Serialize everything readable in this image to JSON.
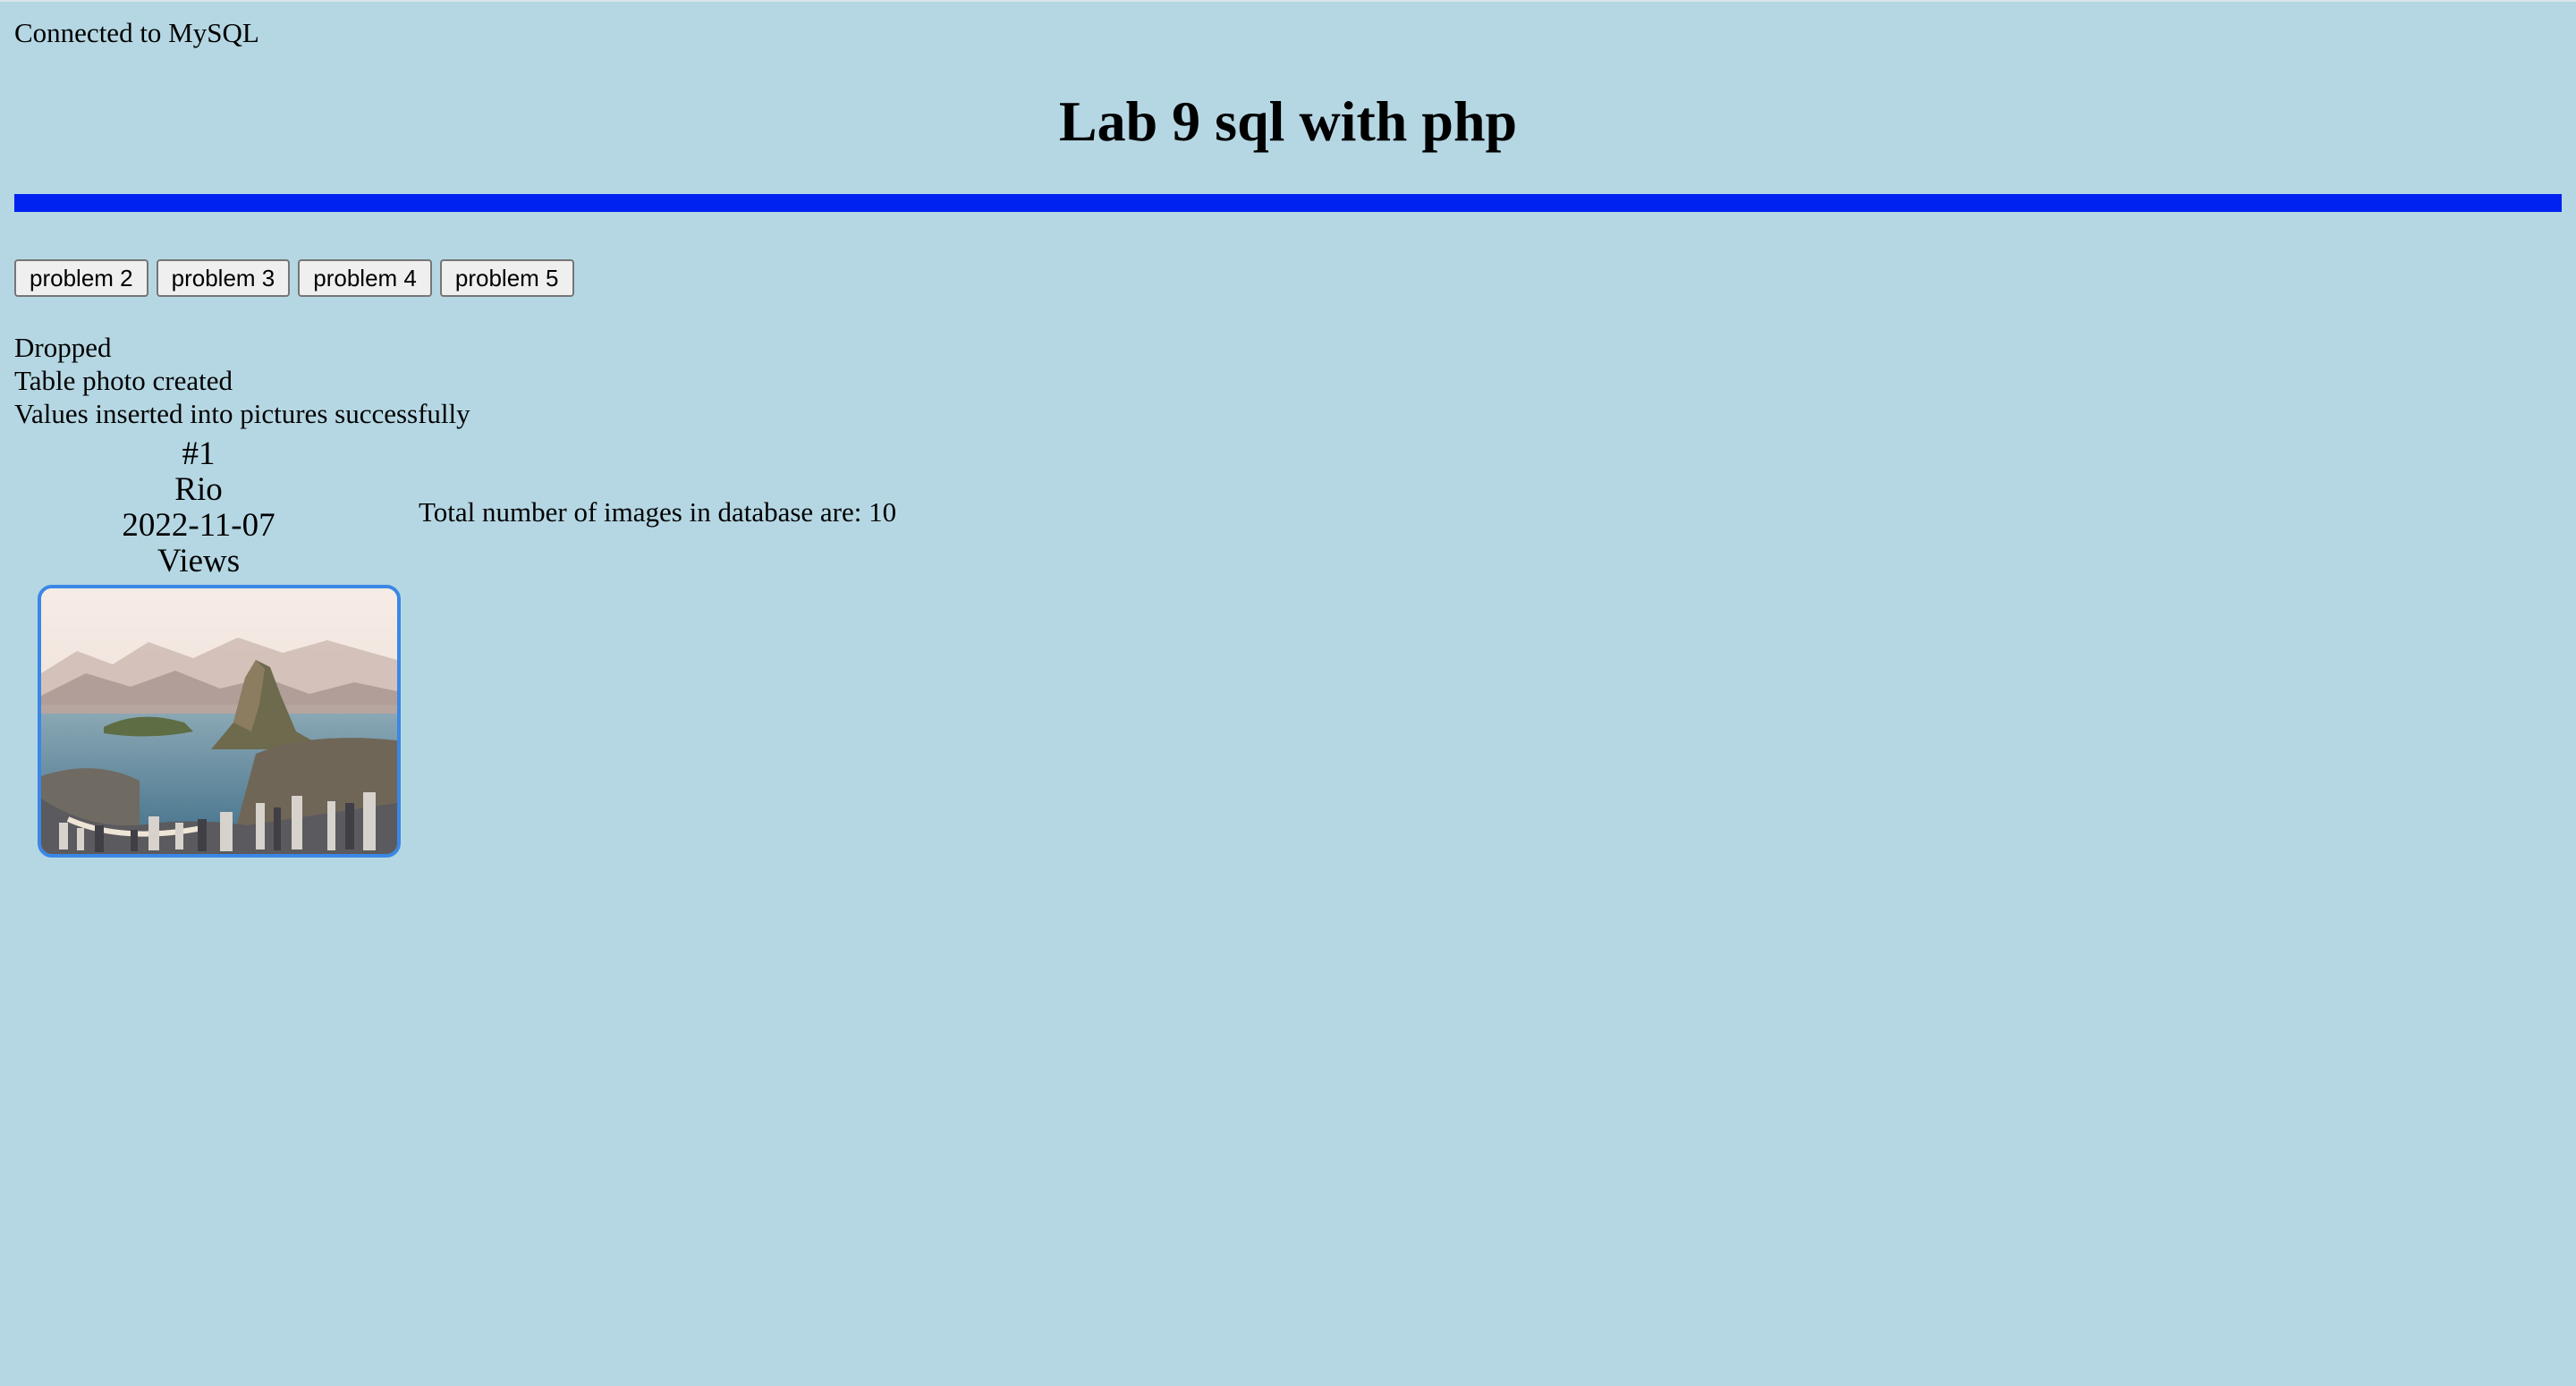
{
  "status": {
    "connection": "Connected to MySQL"
  },
  "header": {
    "title": "Lab 9 sql with php"
  },
  "colors": {
    "background": "#b5d7e3",
    "divider": "#0022f0",
    "photo_border": "#3a87e6"
  },
  "nav": {
    "buttons": [
      {
        "label": "problem 2"
      },
      {
        "label": "problem 3"
      },
      {
        "label": "problem 4"
      },
      {
        "label": "problem 5"
      }
    ]
  },
  "messages": [
    "Dropped",
    "Table photo created",
    "Values inserted into pictures successfully"
  ],
  "picture": {
    "number": "#1",
    "name": "Rio",
    "date": "2022-11-07",
    "views_label": "Views",
    "image_description_icon": "rio-sugarloaf-photo"
  },
  "summary": {
    "total_text": "Total number of images in database are: 10"
  }
}
